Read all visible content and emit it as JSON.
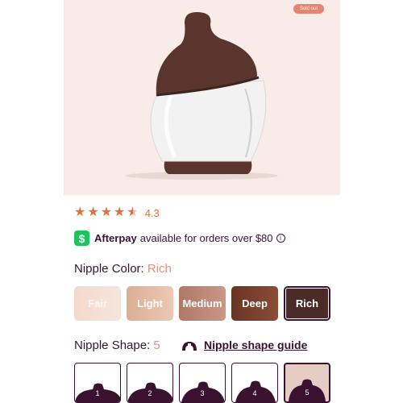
{
  "product": {
    "badge": "Sold out"
  },
  "rating": {
    "value": 4.3,
    "value_text": "4.3",
    "stars_max": 5
  },
  "afterpay": {
    "logo_symbol": "$",
    "brand": "Afterpay",
    "text": "available for orders over $80",
    "info_symbol": "i"
  },
  "nipple_color": {
    "label": "Nipple Color:",
    "selected": "Rich",
    "options": [
      "Fair",
      "Light",
      "Medium",
      "Deep",
      "Rich"
    ]
  },
  "nipple_shape": {
    "label": "Nipple Shape:",
    "selected": "5",
    "guide_link": "Nipple shape guide",
    "options": [
      "1",
      "2",
      "3",
      "4",
      "5"
    ]
  },
  "colors": {
    "accent": "#e2917d",
    "text": "#3a1230",
    "star": "#e0703d",
    "afterpay_green": "#1ec35d",
    "hero_bg": "#f9ece8",
    "rich": "#4a2b28"
  }
}
